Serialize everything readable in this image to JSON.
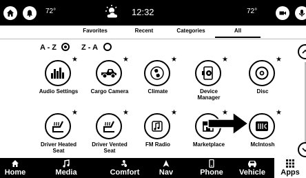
{
  "status_bar": {
    "left_temp": "72°",
    "time": "12:32",
    "right_temp": "72°",
    "icons": [
      "home-icon",
      "alert-icon",
      "partly-cloudy-icon",
      "camera-icon",
      "microphone-icon"
    ]
  },
  "tabs": [
    {
      "label": "Favorites",
      "selected": false
    },
    {
      "label": "Recent",
      "selected": false
    },
    {
      "label": "Categories",
      "selected": false
    },
    {
      "label": "All",
      "selected": true
    }
  ],
  "sort": {
    "az_label": "A - Z",
    "za_label": "Z - A",
    "selected": "A - Z"
  },
  "apps": [
    {
      "label": "Audio Settings",
      "icon": "equalizer-icon",
      "favorite": true
    },
    {
      "label": "Cargo Camera",
      "icon": "pickup-truck-icon",
      "favorite": true
    },
    {
      "label": "Climate",
      "icon": "climate-fan-icon",
      "favorite": true
    },
    {
      "label": "Device Manager",
      "icon": "device-gear-icon",
      "favorite": true
    },
    {
      "label": "Disc",
      "icon": "disc-icon",
      "favorite": true
    },
    {
      "label": "Driver Heated Seat",
      "icon": "heated-seat-icon",
      "favorite": true
    },
    {
      "label": "Driver Vented Seat",
      "icon": "vented-seat-icon",
      "favorite": true
    },
    {
      "label": "FM Radio",
      "icon": "music-note-icon",
      "favorite": true
    },
    {
      "label": "Marketplace",
      "icon": "store-icon",
      "favorite": true
    },
    {
      "label": "McIntosh",
      "icon": "mcintosh-logo-icon",
      "favorite": true
    }
  ],
  "bottom_nav": [
    {
      "label": "Home",
      "icon": "home-icon",
      "active": false
    },
    {
      "label": "Media",
      "icon": "music-note-icon",
      "active": false
    },
    {
      "label": "Comfort",
      "icon": "fan-icon",
      "active": false
    },
    {
      "label": "Nav",
      "icon": "navigation-arrow-icon",
      "active": false
    },
    {
      "label": "Phone",
      "icon": "phone-icon",
      "active": false
    },
    {
      "label": "Vehicle",
      "icon": "car-icon",
      "active": false
    },
    {
      "label": "Apps",
      "icon": "grid-icon",
      "active": true
    }
  ],
  "colors": {
    "bar": "#000000",
    "background": "#ffffff",
    "accent": "#000000"
  }
}
